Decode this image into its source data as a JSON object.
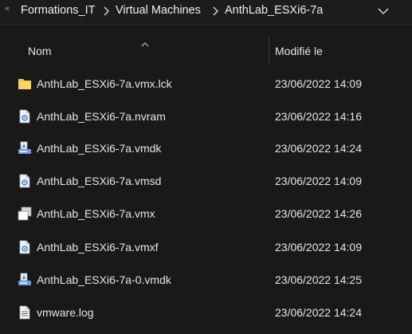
{
  "breadcrumb": {
    "overflow": "«",
    "items": [
      "Formations_IT",
      "Virtual Machines",
      "AnthLab_ESXi6-7a"
    ]
  },
  "columns": {
    "name": "Nom",
    "modified": "Modifié le"
  },
  "files": [
    {
      "name": "AnthLab_ESXi6-7a.vmx.lck",
      "modified": "23/06/2022 14:09",
      "icon": "folder-icon"
    },
    {
      "name": "AnthLab_ESXi6-7a.nvram",
      "modified": "23/06/2022 14:16",
      "icon": "config-file-icon"
    },
    {
      "name": "AnthLab_ESXi6-7a.vmdk",
      "modified": "23/06/2022 14:24",
      "icon": "disk-file-icon"
    },
    {
      "name": "AnthLab_ESXi6-7a.vmsd",
      "modified": "23/06/2022 14:09",
      "icon": "config-file-icon"
    },
    {
      "name": "AnthLab_ESXi6-7a.vmx",
      "modified": "23/06/2022 14:26",
      "icon": "vmx-file-icon"
    },
    {
      "name": "AnthLab_ESXi6-7a.vmxf",
      "modified": "23/06/2022 14:09",
      "icon": "config-file-icon"
    },
    {
      "name": "AnthLab_ESXi6-7a-0.vmdk",
      "modified": "23/06/2022 14:25",
      "icon": "disk-file-icon"
    },
    {
      "name": "vmware.log",
      "modified": "23/06/2022 14:24",
      "icon": "text-file-icon"
    }
  ],
  "colors": {
    "background": "#191919",
    "text": "#e6e6e6",
    "folder": "#f4c24a"
  }
}
